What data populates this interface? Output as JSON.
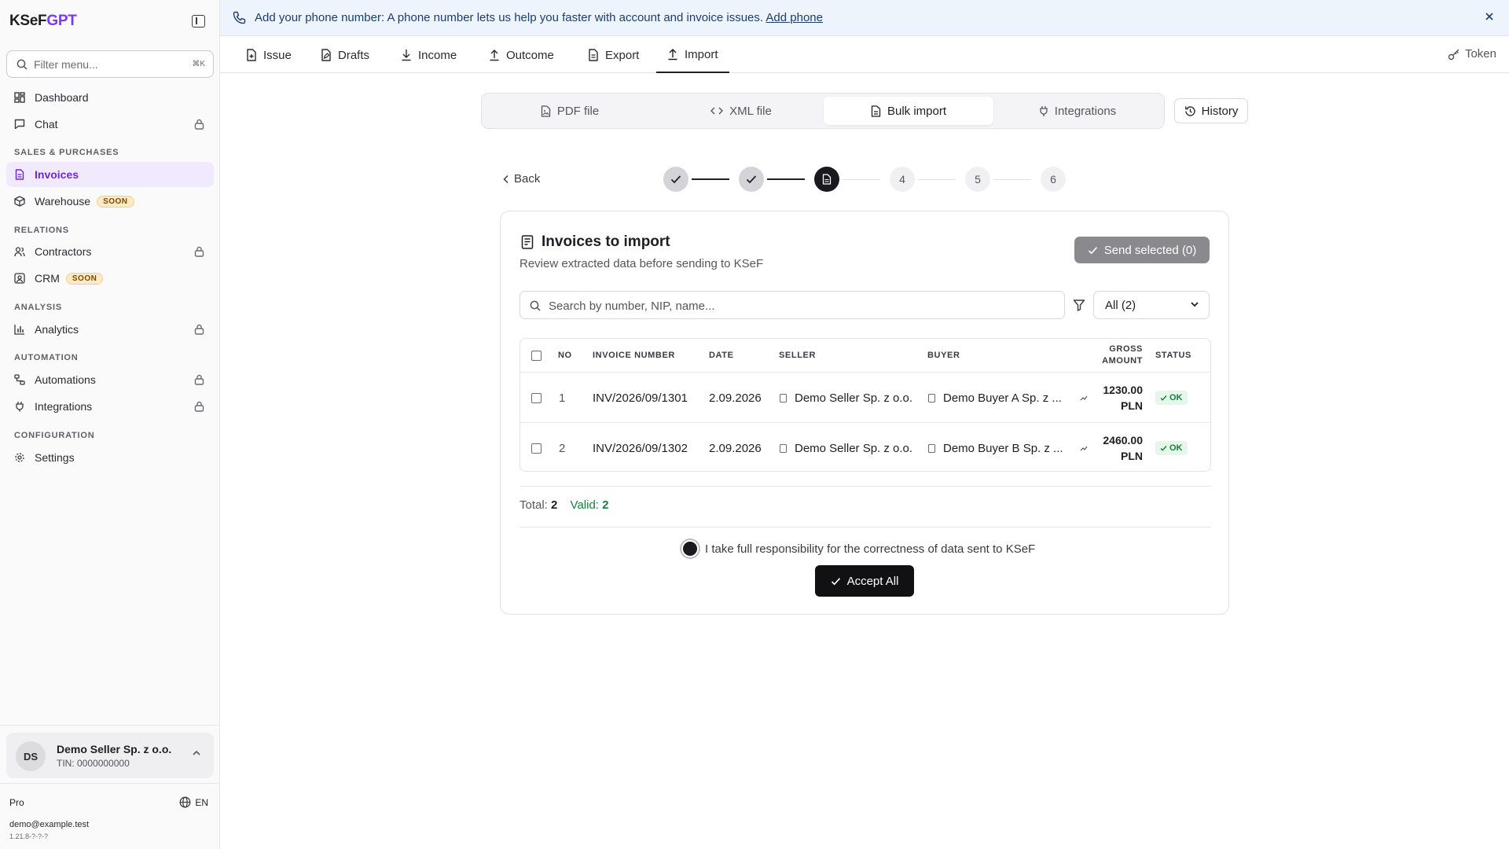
{
  "brand": {
    "name_a": "KSeF",
    "name_b": "GPT"
  },
  "sidebar": {
    "filter_placeholder": "Filter menu...",
    "filter_shortcut": "⌘K",
    "items": [
      {
        "label": "Dashboard"
      },
      {
        "label": "Chat"
      },
      {
        "label": "Invoices"
      },
      {
        "label": "Warehouse",
        "badge": "SOON"
      },
      {
        "label": "Contractors"
      },
      {
        "label": "CRM",
        "badge": "SOON"
      },
      {
        "label": "Analytics"
      },
      {
        "label": "Automations"
      },
      {
        "label": "Integrations"
      },
      {
        "label": "Settings"
      }
    ],
    "sections": {
      "sales": "SALES & PURCHASES",
      "relations": "RELATIONS",
      "analysis": "ANALYSIS",
      "automation": "AUTOMATION",
      "configuration": "CONFIGURATION"
    },
    "account": {
      "initials": "DS",
      "name": "Demo Seller Sp. z o.o.",
      "tin": "TIN: 0000000000"
    },
    "plan": "Pro",
    "language": "EN",
    "email": "demo@example.test",
    "version": "1.21.8-?-?-?"
  },
  "banner": {
    "text": "Add your phone number: A phone number lets us help you faster with account and invoice issues.",
    "link": "Add phone"
  },
  "tabs": [
    {
      "label": "Issue"
    },
    {
      "label": "Drafts"
    },
    {
      "label": "Income"
    },
    {
      "label": "Outcome"
    },
    {
      "label": "Export"
    },
    {
      "label": "Import"
    }
  ],
  "token_label": "Token",
  "source_tabs": [
    {
      "label": "PDF file"
    },
    {
      "label": "XML file"
    },
    {
      "label": "Bulk import"
    },
    {
      "label": "Integrations"
    }
  ],
  "history_label": "History",
  "back_label": "Back",
  "steps": [
    "4",
    "5",
    "6"
  ],
  "card": {
    "title": "Invoices to import",
    "subtitle": "Review extracted data before sending to KSeF",
    "send_button": "Send selected (0)",
    "search_placeholder": "Search by number, NIP, name...",
    "filter_value": "All (2)",
    "columns": {
      "no": "NO",
      "invoice_number": "INVOICE NUMBER",
      "date": "DATE",
      "seller": "SELLER",
      "buyer": "BUYER",
      "gross_1": "GROSS",
      "gross_2": "AMOUNT",
      "status": "STATUS"
    },
    "rows": [
      {
        "no": "1",
        "invoice_number": "INV/2026/09/1301",
        "date": "2.09.2026",
        "seller": "Demo Seller Sp. z o.o.",
        "buyer": "Demo Buyer A Sp. z ...",
        "amount": "1230.00",
        "currency": "PLN",
        "status": "OK"
      },
      {
        "no": "2",
        "invoice_number": "INV/2026/09/1302",
        "date": "2.09.2026",
        "seller": "Demo Seller Sp. z o.o.",
        "buyer": "Demo Buyer B Sp. z ...",
        "amount": "2460.00",
        "currency": "PLN",
        "status": "OK"
      }
    ],
    "total_label": "Total:",
    "total_value": "2",
    "valid_label": "Valid:",
    "valid_value": "2",
    "responsibility": "I take full responsibility for the correctness of data sent to KSeF",
    "accept_button": "Accept All"
  }
}
